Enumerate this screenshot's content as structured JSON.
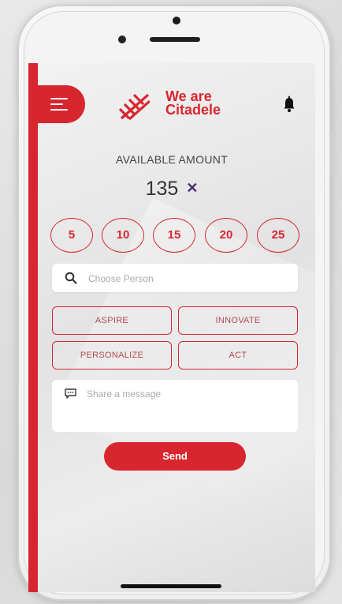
{
  "brand": {
    "logo_line1": "We are",
    "logo_line2": "Citadele",
    "accent_color": "#d8262f"
  },
  "header": {
    "menu_icon": "hamburger-menu-icon",
    "bell_icon": "bell-icon"
  },
  "amount": {
    "label": "AVAILABLE AMOUNT",
    "value": "135",
    "clear_icon": "close-icon"
  },
  "quick_amounts": [
    "5",
    "10",
    "15",
    "20",
    "25"
  ],
  "search": {
    "placeholder": "Choose Person",
    "value": "",
    "icon": "search-icon"
  },
  "values": [
    {
      "label": "ASPIRE"
    },
    {
      "label": "INNOVATE"
    },
    {
      "label": "PERSONALIZE"
    },
    {
      "label": "ACT"
    }
  ],
  "message": {
    "placeholder": "Share a message",
    "icon": "chat-bubble-icon"
  },
  "send": {
    "label": "Send"
  }
}
